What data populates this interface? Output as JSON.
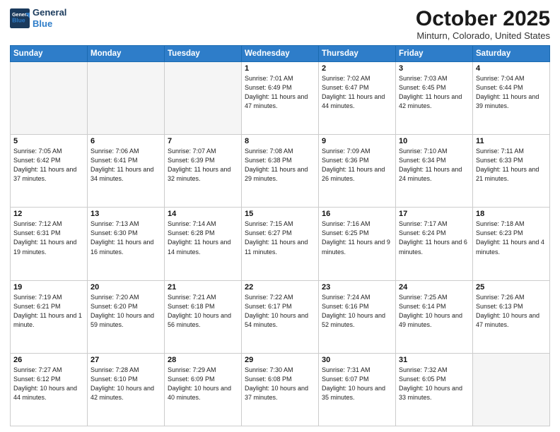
{
  "header": {
    "logo_line1": "General",
    "logo_line2": "Blue",
    "month": "October 2025",
    "location": "Minturn, Colorado, United States"
  },
  "days_of_week": [
    "Sunday",
    "Monday",
    "Tuesday",
    "Wednesday",
    "Thursday",
    "Friday",
    "Saturday"
  ],
  "weeks": [
    [
      {
        "day": "",
        "empty": true
      },
      {
        "day": "",
        "empty": true
      },
      {
        "day": "",
        "empty": true
      },
      {
        "day": "1",
        "sunrise": "7:01 AM",
        "sunset": "6:49 PM",
        "daylight": "11 hours and 47 minutes."
      },
      {
        "day": "2",
        "sunrise": "7:02 AM",
        "sunset": "6:47 PM",
        "daylight": "11 hours and 44 minutes."
      },
      {
        "day": "3",
        "sunrise": "7:03 AM",
        "sunset": "6:45 PM",
        "daylight": "11 hours and 42 minutes."
      },
      {
        "day": "4",
        "sunrise": "7:04 AM",
        "sunset": "6:44 PM",
        "daylight": "11 hours and 39 minutes."
      }
    ],
    [
      {
        "day": "5",
        "sunrise": "7:05 AM",
        "sunset": "6:42 PM",
        "daylight": "11 hours and 37 minutes."
      },
      {
        "day": "6",
        "sunrise": "7:06 AM",
        "sunset": "6:41 PM",
        "daylight": "11 hours and 34 minutes."
      },
      {
        "day": "7",
        "sunrise": "7:07 AM",
        "sunset": "6:39 PM",
        "daylight": "11 hours and 32 minutes."
      },
      {
        "day": "8",
        "sunrise": "7:08 AM",
        "sunset": "6:38 PM",
        "daylight": "11 hours and 29 minutes."
      },
      {
        "day": "9",
        "sunrise": "7:09 AM",
        "sunset": "6:36 PM",
        "daylight": "11 hours and 26 minutes."
      },
      {
        "day": "10",
        "sunrise": "7:10 AM",
        "sunset": "6:34 PM",
        "daylight": "11 hours and 24 minutes."
      },
      {
        "day": "11",
        "sunrise": "7:11 AM",
        "sunset": "6:33 PM",
        "daylight": "11 hours and 21 minutes."
      }
    ],
    [
      {
        "day": "12",
        "sunrise": "7:12 AM",
        "sunset": "6:31 PM",
        "daylight": "11 hours and 19 minutes."
      },
      {
        "day": "13",
        "sunrise": "7:13 AM",
        "sunset": "6:30 PM",
        "daylight": "11 hours and 16 minutes."
      },
      {
        "day": "14",
        "sunrise": "7:14 AM",
        "sunset": "6:28 PM",
        "daylight": "11 hours and 14 minutes."
      },
      {
        "day": "15",
        "sunrise": "7:15 AM",
        "sunset": "6:27 PM",
        "daylight": "11 hours and 11 minutes."
      },
      {
        "day": "16",
        "sunrise": "7:16 AM",
        "sunset": "6:25 PM",
        "daylight": "11 hours and 9 minutes."
      },
      {
        "day": "17",
        "sunrise": "7:17 AM",
        "sunset": "6:24 PM",
        "daylight": "11 hours and 6 minutes."
      },
      {
        "day": "18",
        "sunrise": "7:18 AM",
        "sunset": "6:23 PM",
        "daylight": "11 hours and 4 minutes."
      }
    ],
    [
      {
        "day": "19",
        "sunrise": "7:19 AM",
        "sunset": "6:21 PM",
        "daylight": "11 hours and 1 minute."
      },
      {
        "day": "20",
        "sunrise": "7:20 AM",
        "sunset": "6:20 PM",
        "daylight": "10 hours and 59 minutes."
      },
      {
        "day": "21",
        "sunrise": "7:21 AM",
        "sunset": "6:18 PM",
        "daylight": "10 hours and 56 minutes."
      },
      {
        "day": "22",
        "sunrise": "7:22 AM",
        "sunset": "6:17 PM",
        "daylight": "10 hours and 54 minutes."
      },
      {
        "day": "23",
        "sunrise": "7:24 AM",
        "sunset": "6:16 PM",
        "daylight": "10 hours and 52 minutes."
      },
      {
        "day": "24",
        "sunrise": "7:25 AM",
        "sunset": "6:14 PM",
        "daylight": "10 hours and 49 minutes."
      },
      {
        "day": "25",
        "sunrise": "7:26 AM",
        "sunset": "6:13 PM",
        "daylight": "10 hours and 47 minutes."
      }
    ],
    [
      {
        "day": "26",
        "sunrise": "7:27 AM",
        "sunset": "6:12 PM",
        "daylight": "10 hours and 44 minutes."
      },
      {
        "day": "27",
        "sunrise": "7:28 AM",
        "sunset": "6:10 PM",
        "daylight": "10 hours and 42 minutes."
      },
      {
        "day": "28",
        "sunrise": "7:29 AM",
        "sunset": "6:09 PM",
        "daylight": "10 hours and 40 minutes."
      },
      {
        "day": "29",
        "sunrise": "7:30 AM",
        "sunset": "6:08 PM",
        "daylight": "10 hours and 37 minutes."
      },
      {
        "day": "30",
        "sunrise": "7:31 AM",
        "sunset": "6:07 PM",
        "daylight": "10 hours and 35 minutes."
      },
      {
        "day": "31",
        "sunrise": "7:32 AM",
        "sunset": "6:05 PM",
        "daylight": "10 hours and 33 minutes."
      },
      {
        "day": "",
        "empty": true
      }
    ]
  ]
}
